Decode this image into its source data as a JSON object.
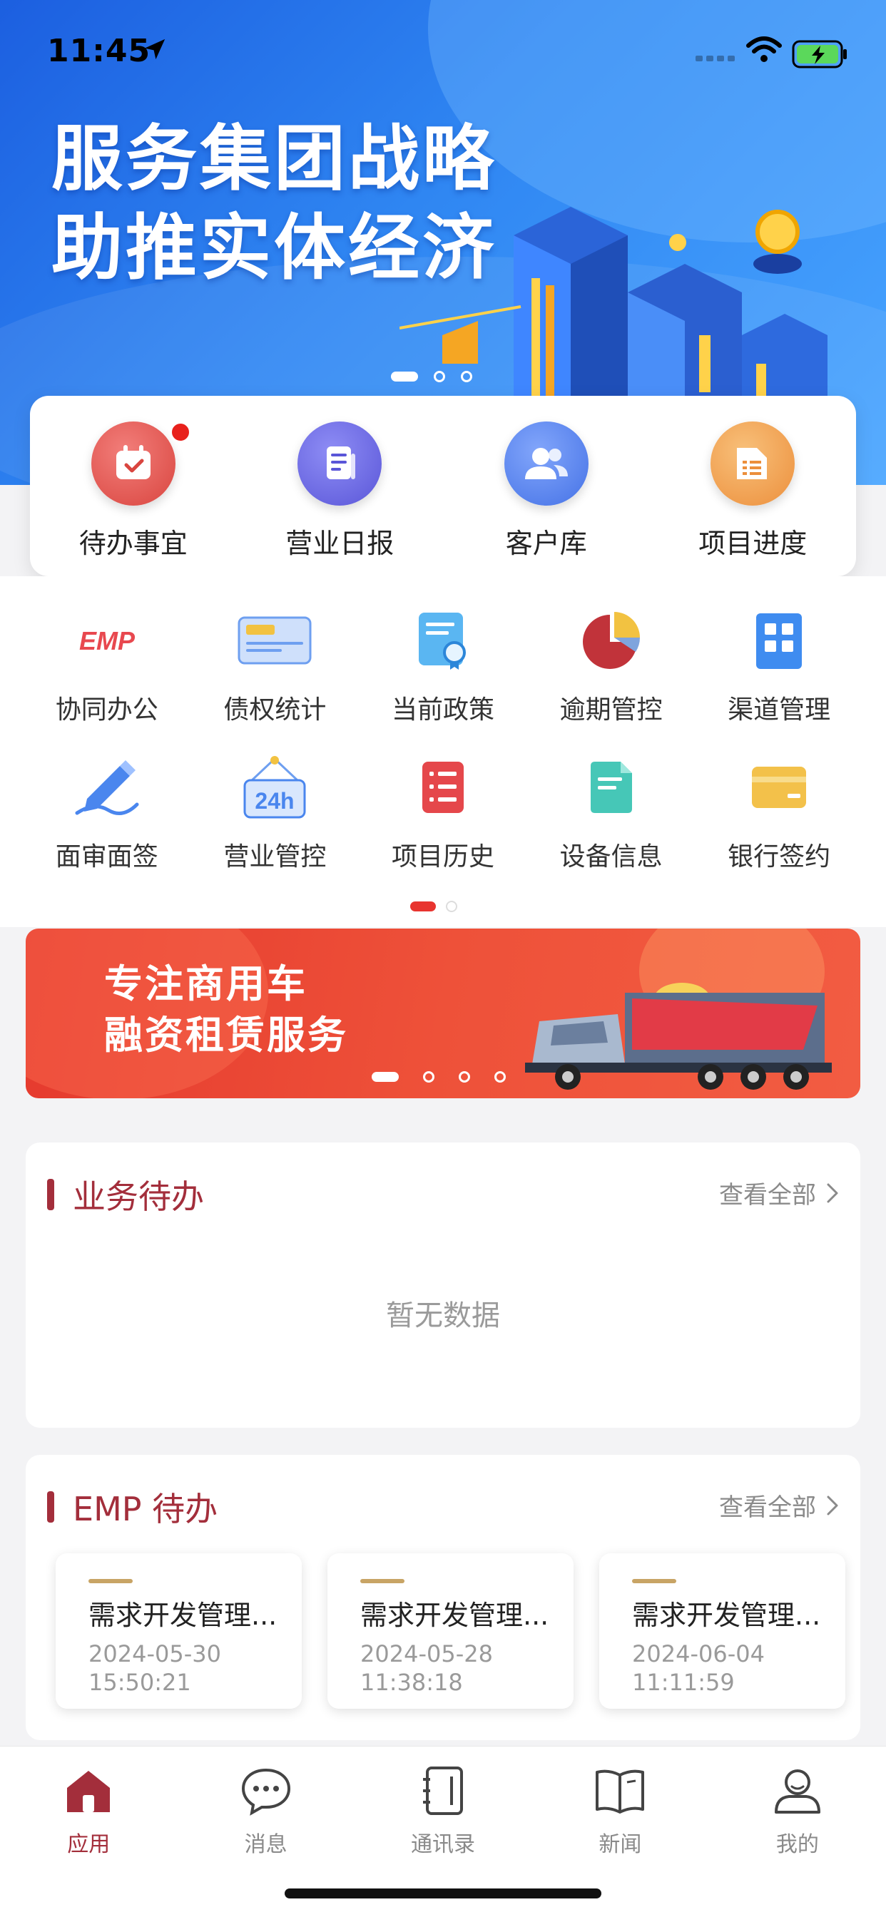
{
  "status_bar": {
    "time": "11:45"
  },
  "hero": {
    "title_line1": "服务集团战略",
    "title_line2": "助推实体经济"
  },
  "quick_actions": [
    {
      "label": "待办事宜",
      "icon": "calendar-check-icon",
      "color": "#e8575a",
      "badge": true
    },
    {
      "label": "营业日报",
      "icon": "document-icon",
      "color": "#6f6de8",
      "badge": false
    },
    {
      "label": "客户库",
      "icon": "users-icon",
      "color": "#5c86ee",
      "badge": false
    },
    {
      "label": "项目进度",
      "icon": "folder-list-icon",
      "color": "#f0a15a",
      "badge": false
    }
  ],
  "grid_items": [
    {
      "label": "协同办公",
      "icon": "emp-logo-icon"
    },
    {
      "label": "债权统计",
      "icon": "card-icon"
    },
    {
      "label": "当前政策",
      "icon": "policy-certificate-icon"
    },
    {
      "label": "逾期管控",
      "icon": "pie-chart-icon"
    },
    {
      "label": "渠道管理",
      "icon": "building-icon"
    },
    {
      "label": "面审面签",
      "icon": "pen-sign-icon"
    },
    {
      "label": "营业管控",
      "icon": "24h-sign-icon"
    },
    {
      "label": "项目历史",
      "icon": "list-doc-icon"
    },
    {
      "label": "设备信息",
      "icon": "device-doc-icon"
    },
    {
      "label": "银行签约",
      "icon": "bank-card-icon"
    }
  ],
  "promo": {
    "line1": "专注商用车",
    "line2": "融资租赁服务"
  },
  "business_todo": {
    "title": "业务待办",
    "see_all": "查看全部",
    "empty_text": "暂无数据"
  },
  "emp_todo": {
    "title": "EMP 待办",
    "see_all": "查看全部",
    "items": [
      {
        "title": "需求开发管理...",
        "date": "2024-05-30",
        "time": "15:50:21"
      },
      {
        "title": "需求开发管理...",
        "date": "2024-05-28",
        "time": "11:38:18"
      },
      {
        "title": "需求开发管理...",
        "date": "2024-06-04",
        "time": "11:11:59"
      }
    ]
  },
  "tabbar": {
    "active": "应用",
    "tabs": [
      {
        "label": "应用",
        "icon": "home-icon"
      },
      {
        "label": "消息",
        "icon": "chat-bubble-icon"
      },
      {
        "label": "通讯录",
        "icon": "contacts-book-icon"
      },
      {
        "label": "新闻",
        "icon": "open-book-icon"
      },
      {
        "label": "我的",
        "icon": "user-icon"
      }
    ]
  },
  "colors": {
    "accent": "#a32e3b",
    "badge": "#e8211c",
    "hero_blue": "#2f86f2",
    "promo_red": "#e53a2e",
    "todo_accent": "#c8a465"
  }
}
